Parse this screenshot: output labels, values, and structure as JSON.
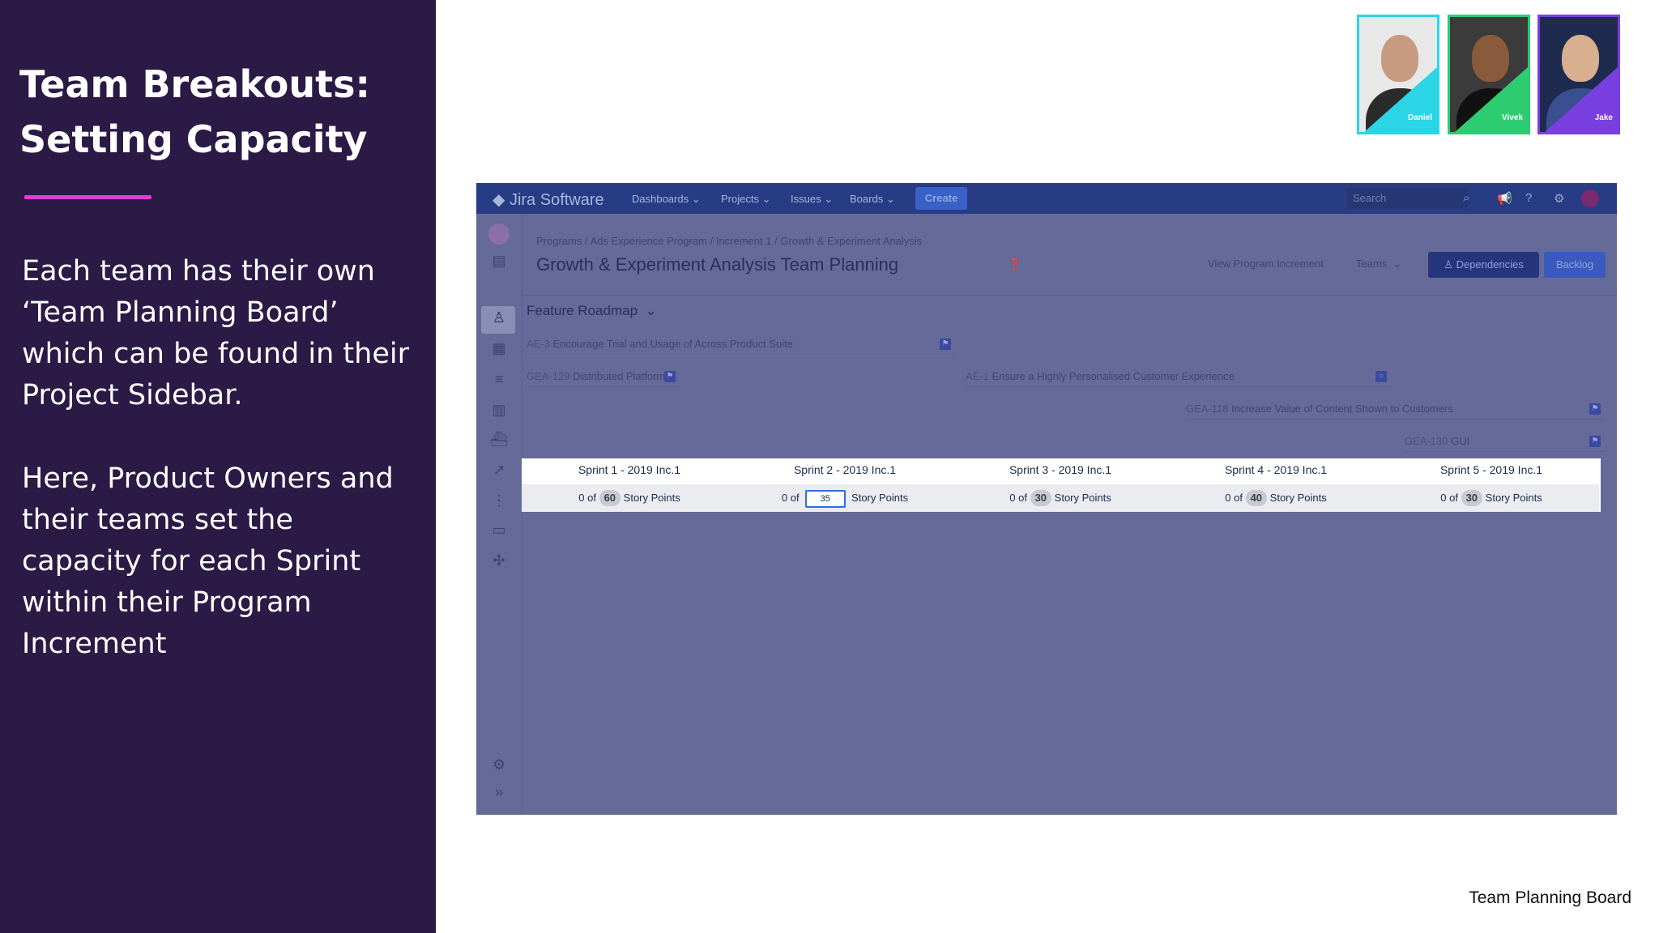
{
  "slide": {
    "title_line1": "Team Breakouts:",
    "title_line2": "Setting Capacity",
    "para1": "Each team has their own ‘Team Planning Board’ which can be found in their Project Sidebar.",
    "para2": "Here, Product Owners and their teams set the capacity for each Sprint within their Program Increment",
    "footer": "Team Planning Board",
    "accent_color": "#e040d0",
    "bg_color": "#2a1a45"
  },
  "avatars": [
    {
      "name": "Daniel",
      "color": "#2ad6e6"
    },
    {
      "name": "Vivek",
      "color": "#2ecc71"
    },
    {
      "name": "Jake",
      "color": "#7a3fe0"
    }
  ],
  "jira": {
    "logo": "Jira Software",
    "nav": [
      "Dashboards",
      "Projects",
      "Issues",
      "Boards"
    ],
    "create_label": "Create",
    "search_placeholder": "Search",
    "breadcrumb": "Programs  / Ads Experience Program  / Increment 1  / Growth & Experiment Analysis",
    "page_title": "Growth & Experiment Analysis Team Planning",
    "view_pi": "View Program Increment",
    "teams": "Teams",
    "dependencies": "Dependencies",
    "backlog": "Backlog",
    "roadmap_label": "Feature Roadmap",
    "features": [
      {
        "key": "AE-3",
        "title": "Encourage Trial and Usage of Across Product Suite"
      },
      {
        "key": "GEA-129",
        "title": "Distributed Platform"
      },
      {
        "key": "AE-1",
        "title": "Ensure a Highly Personalised Customer Experience"
      },
      {
        "key": "GEA-118",
        "title": "Increase Value of Content Shown to Customers"
      },
      {
        "key": "GEA-130",
        "title": "GUI"
      }
    ],
    "sprints": [
      {
        "name": "Sprint 1 - 2019 Inc.1",
        "prefix": "0 of",
        "capacity": "60",
        "unit": "Story Points"
      },
      {
        "name": "Sprint 2 - 2019 Inc.1",
        "prefix": "0 of",
        "capacity": "35",
        "unit": "Story Points"
      },
      {
        "name": "Sprint 3 - 2019 Inc.1",
        "prefix": "0 of",
        "capacity": "30",
        "unit": "Story Points"
      },
      {
        "name": "Sprint 4 - 2019 Inc.1",
        "prefix": "0 of",
        "capacity": "40",
        "unit": "Story Points"
      },
      {
        "name": "Sprint 5 - 2019 Inc.1",
        "prefix": "0 of",
        "capacity": "30",
        "unit": "Story Points"
      }
    ]
  }
}
